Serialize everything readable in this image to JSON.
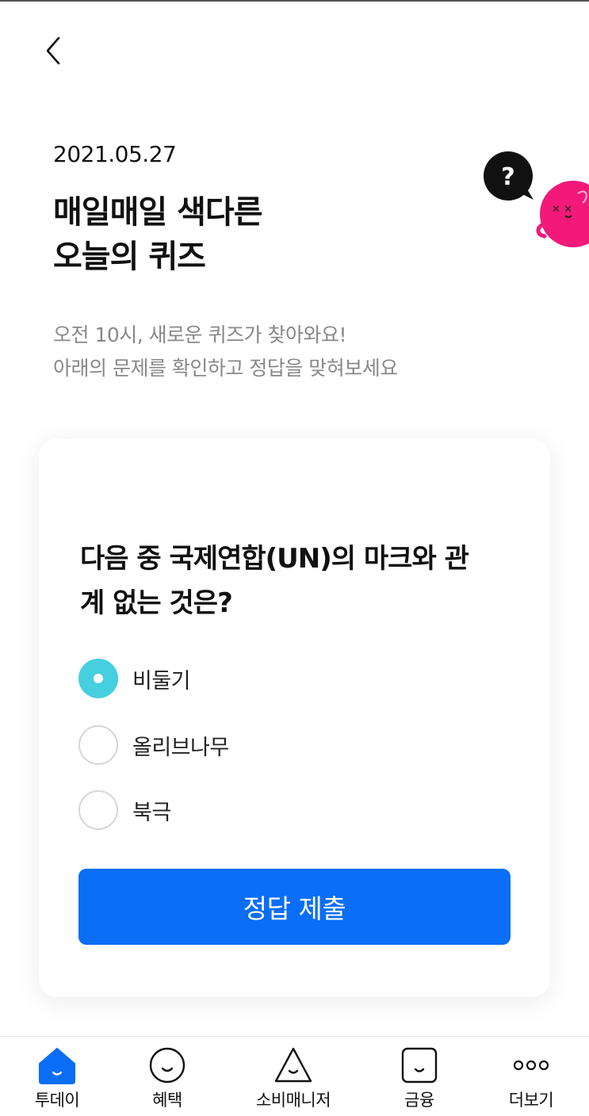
{
  "header": {
    "back_icon": "chevron-left-icon"
  },
  "hero": {
    "date": "2021.05.27",
    "title_line1": "매일매일 색다른",
    "title_line2": "오늘의 퀴즈",
    "subtitle_line1": "오전 10시, 새로운 퀴즈가 찾아와요!",
    "subtitle_line2": "아래의 문제를 확인하고 정답을 맞혀보세요",
    "mascot_icon": "question-mascot-icon"
  },
  "quiz": {
    "question_line1": "다음 중 국제연합(UN)의 마크와 관",
    "question_line2": "계 없는 것은?",
    "options": [
      {
        "label": "비둘기",
        "selected": true
      },
      {
        "label": "올리브나무",
        "selected": false
      },
      {
        "label": "북극",
        "selected": false
      }
    ],
    "submit_label": "정답 제출"
  },
  "tabbar": {
    "items": [
      {
        "label": "투데이",
        "icon": "home-icon",
        "active": true
      },
      {
        "label": "혜택",
        "icon": "smile-circle-icon",
        "active": false
      },
      {
        "label": "소비매니저",
        "icon": "triangle-face-icon",
        "active": false
      },
      {
        "label": "금융",
        "icon": "square-face-icon",
        "active": false
      },
      {
        "label": "더보기",
        "icon": "more-dots-icon",
        "active": false
      }
    ]
  },
  "colors": {
    "accent_blue": "#0a6ef7",
    "radio_selected": "#45cfe0",
    "mascot_pink": "#f2197a",
    "subtitle_gray": "#888888"
  }
}
